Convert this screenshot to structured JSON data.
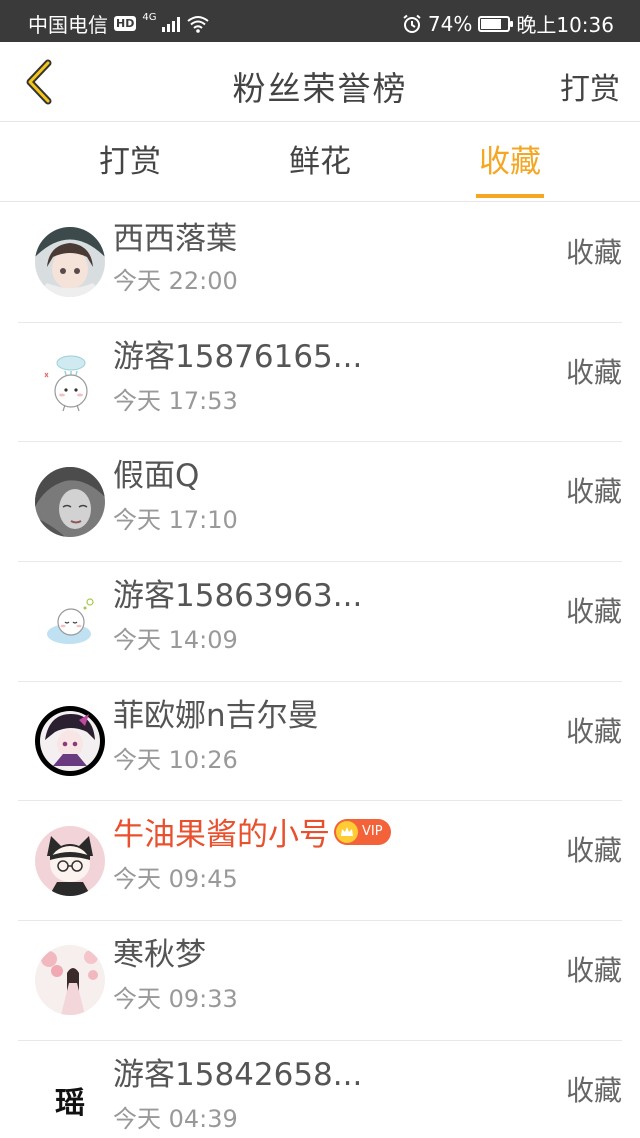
{
  "status_bar": {
    "carrier": "中国电信",
    "hd": "HD",
    "network": "4G",
    "battery_percent": "74%",
    "battery_level": 0.74,
    "time": "晚上10:36"
  },
  "header": {
    "title": "粉丝荣誉榜",
    "action_label": "打赏",
    "back_icon": "chevron-left-icon"
  },
  "tabs": [
    {
      "label": "打赏",
      "active": false
    },
    {
      "label": "鲜花",
      "active": false
    },
    {
      "label": "收藏",
      "active": true
    }
  ],
  "colors": {
    "accent": "#f5a623",
    "vip_name": "#e8502e",
    "status_bar": "#3a3a3a"
  },
  "fans": [
    {
      "name": "西西落葉",
      "time": "今天 22:00",
      "action": "收藏",
      "vip": false,
      "avatar": "anime-girl-avatar"
    },
    {
      "name": "游客15876165...",
      "time": "今天 17:53",
      "action": "收藏",
      "vip": false,
      "avatar": "cloud-character-avatar"
    },
    {
      "name": "假面Q",
      "time": "今天 17:10",
      "action": "收藏",
      "vip": false,
      "avatar": "grayscale-portrait-avatar"
    },
    {
      "name": "游客15863963...",
      "time": "今天 14:09",
      "action": "收藏",
      "vip": false,
      "avatar": "sleeping-character-avatar"
    },
    {
      "name": "菲欧娜n吉尔曼",
      "time": "今天 10:26",
      "action": "收藏",
      "vip": false,
      "avatar": "dark-anime-avatar"
    },
    {
      "name": "牛油果酱的小号",
      "time": "今天 09:45",
      "action": "收藏",
      "vip": true,
      "vip_label": "VIP",
      "avatar": "glasses-character-avatar"
    },
    {
      "name": "寒秋梦",
      "time": "今天 09:33",
      "action": "收藏",
      "vip": false,
      "avatar": "cherry-blossom-avatar"
    },
    {
      "name": "游客15842658...",
      "time": "今天 04:39",
      "action": "收藏",
      "vip": false,
      "avatar": "calligraphy-avatar",
      "avatar_text": "瑶"
    }
  ]
}
